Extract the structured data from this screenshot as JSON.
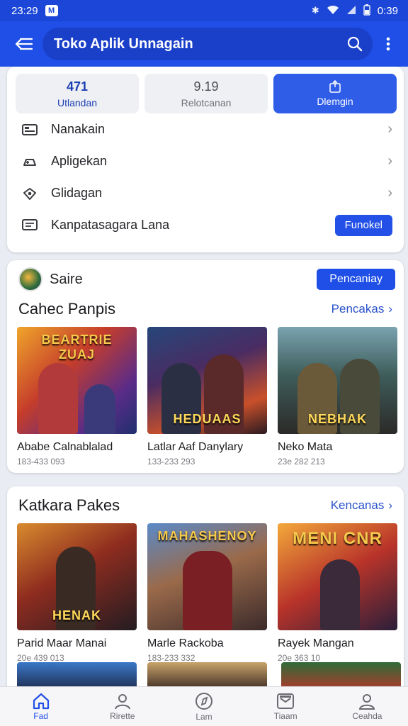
{
  "status_bar": {
    "time_left": "23:29",
    "time_right": "0:39"
  },
  "app_bar": {
    "title": "Toko Aplik Unnagain"
  },
  "stats": [
    {
      "value": "471",
      "label": "Utlandan"
    },
    {
      "value": "9.19",
      "label": "Relotcanan"
    },
    {
      "value": "",
      "label": "Dlemgin"
    }
  ],
  "menu_rows": [
    {
      "label": "Nanakain",
      "icon": "ticket-icon"
    },
    {
      "label": "Apligekan",
      "icon": "gamepad-icon"
    },
    {
      "label": "Glidagan",
      "icon": "heart-icon"
    },
    {
      "label": "Kanpatasagara Lana",
      "icon": "message-icon",
      "button": "Funokel"
    }
  ],
  "section1": {
    "header_label": "Saire",
    "header_button": "Pencaniay",
    "title": "Cahec Panpis",
    "link": "Pencakas",
    "games": [
      {
        "name": "Ababe Calnablalad",
        "meta": "183-433 093",
        "logo": "BEARTRIE ZUAJ"
      },
      {
        "name": "Latlar Aaf Danylary",
        "meta": "133-233 293",
        "logo": "HEDUAAS"
      },
      {
        "name": "Neko Mata",
        "meta": "23e 282 213",
        "logo": "NEBHAK"
      }
    ]
  },
  "section2": {
    "title": "Katkara Pakes",
    "link": "Kencanas",
    "games": [
      {
        "name": "Parid Maar Manai",
        "meta": "20e 439 013",
        "logo": "HENAK"
      },
      {
        "name": "Marle Rackoba",
        "meta": "183-233 332",
        "logo": "MAHASHENOY"
      },
      {
        "name": "Rayek Mangan",
        "meta": "20e 363 10",
        "logo": "MENI CNR"
      }
    ]
  },
  "bottom_nav": [
    {
      "label": "Fad",
      "icon": "home-icon"
    },
    {
      "label": "Rirette",
      "icon": "person-icon"
    },
    {
      "label": "Lam",
      "icon": "compass-icon"
    },
    {
      "label": "Tiaam",
      "icon": "inbox-icon"
    },
    {
      "label": "Ceahda",
      "icon": "profile-icon"
    }
  ],
  "colors": {
    "primary": "#1f4fe6",
    "accent_text": "#2a52c9",
    "background": "#e9ecf2"
  }
}
